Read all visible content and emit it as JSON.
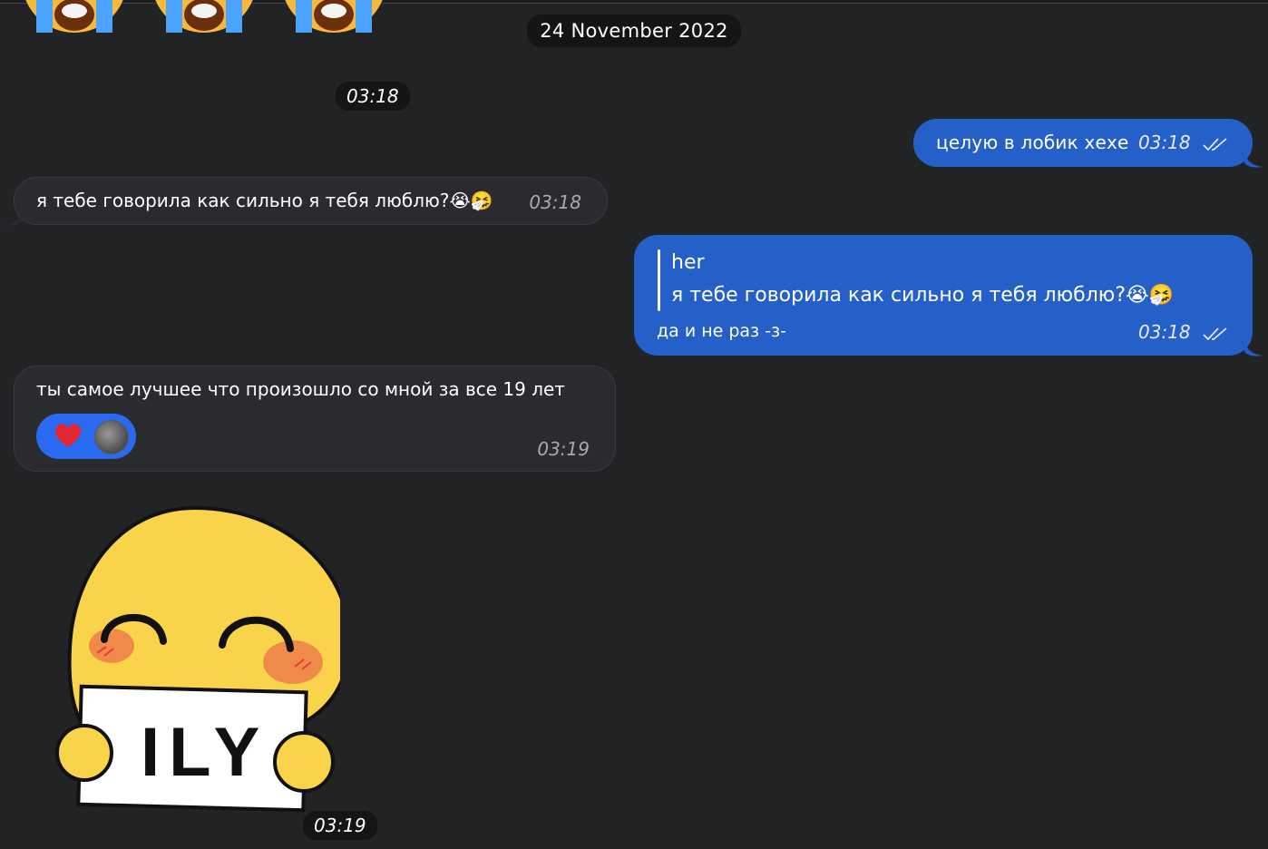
{
  "date_separator": "24 November 2022",
  "messages": [
    {
      "id": "m0",
      "direction": "in",
      "type": "emoji-group",
      "time": "03:18"
    },
    {
      "id": "m1",
      "direction": "out",
      "text": "целую в лобик хехе",
      "time": "03:18",
      "status": "read"
    },
    {
      "id": "m2",
      "direction": "in",
      "text": "я тебе говорила как сильно я тебя люблю?😭🤧",
      "time": "03:18"
    },
    {
      "id": "m3",
      "direction": "out",
      "reply_to": {
        "author": "her",
        "text": "я тебе говорила как сильно я тебя люблю?😭🤧"
      },
      "text": "да и не раз -з-",
      "time": "03:18",
      "status": "read"
    },
    {
      "id": "m4",
      "direction": "in",
      "text": "ты самое лучшее что произошло со мной за все 19 лет",
      "time": "03:19",
      "reaction": {
        "emoji": "heart-icon"
      }
    },
    {
      "id": "m5",
      "direction": "in",
      "type": "sticker",
      "sticker_text": "ILY",
      "time": "03:19"
    }
  ],
  "colors": {
    "background": "#222325",
    "bubble_in": "#2a2b2e",
    "bubble_out": "#2560c9",
    "reaction_bg": "#2a6af0"
  }
}
